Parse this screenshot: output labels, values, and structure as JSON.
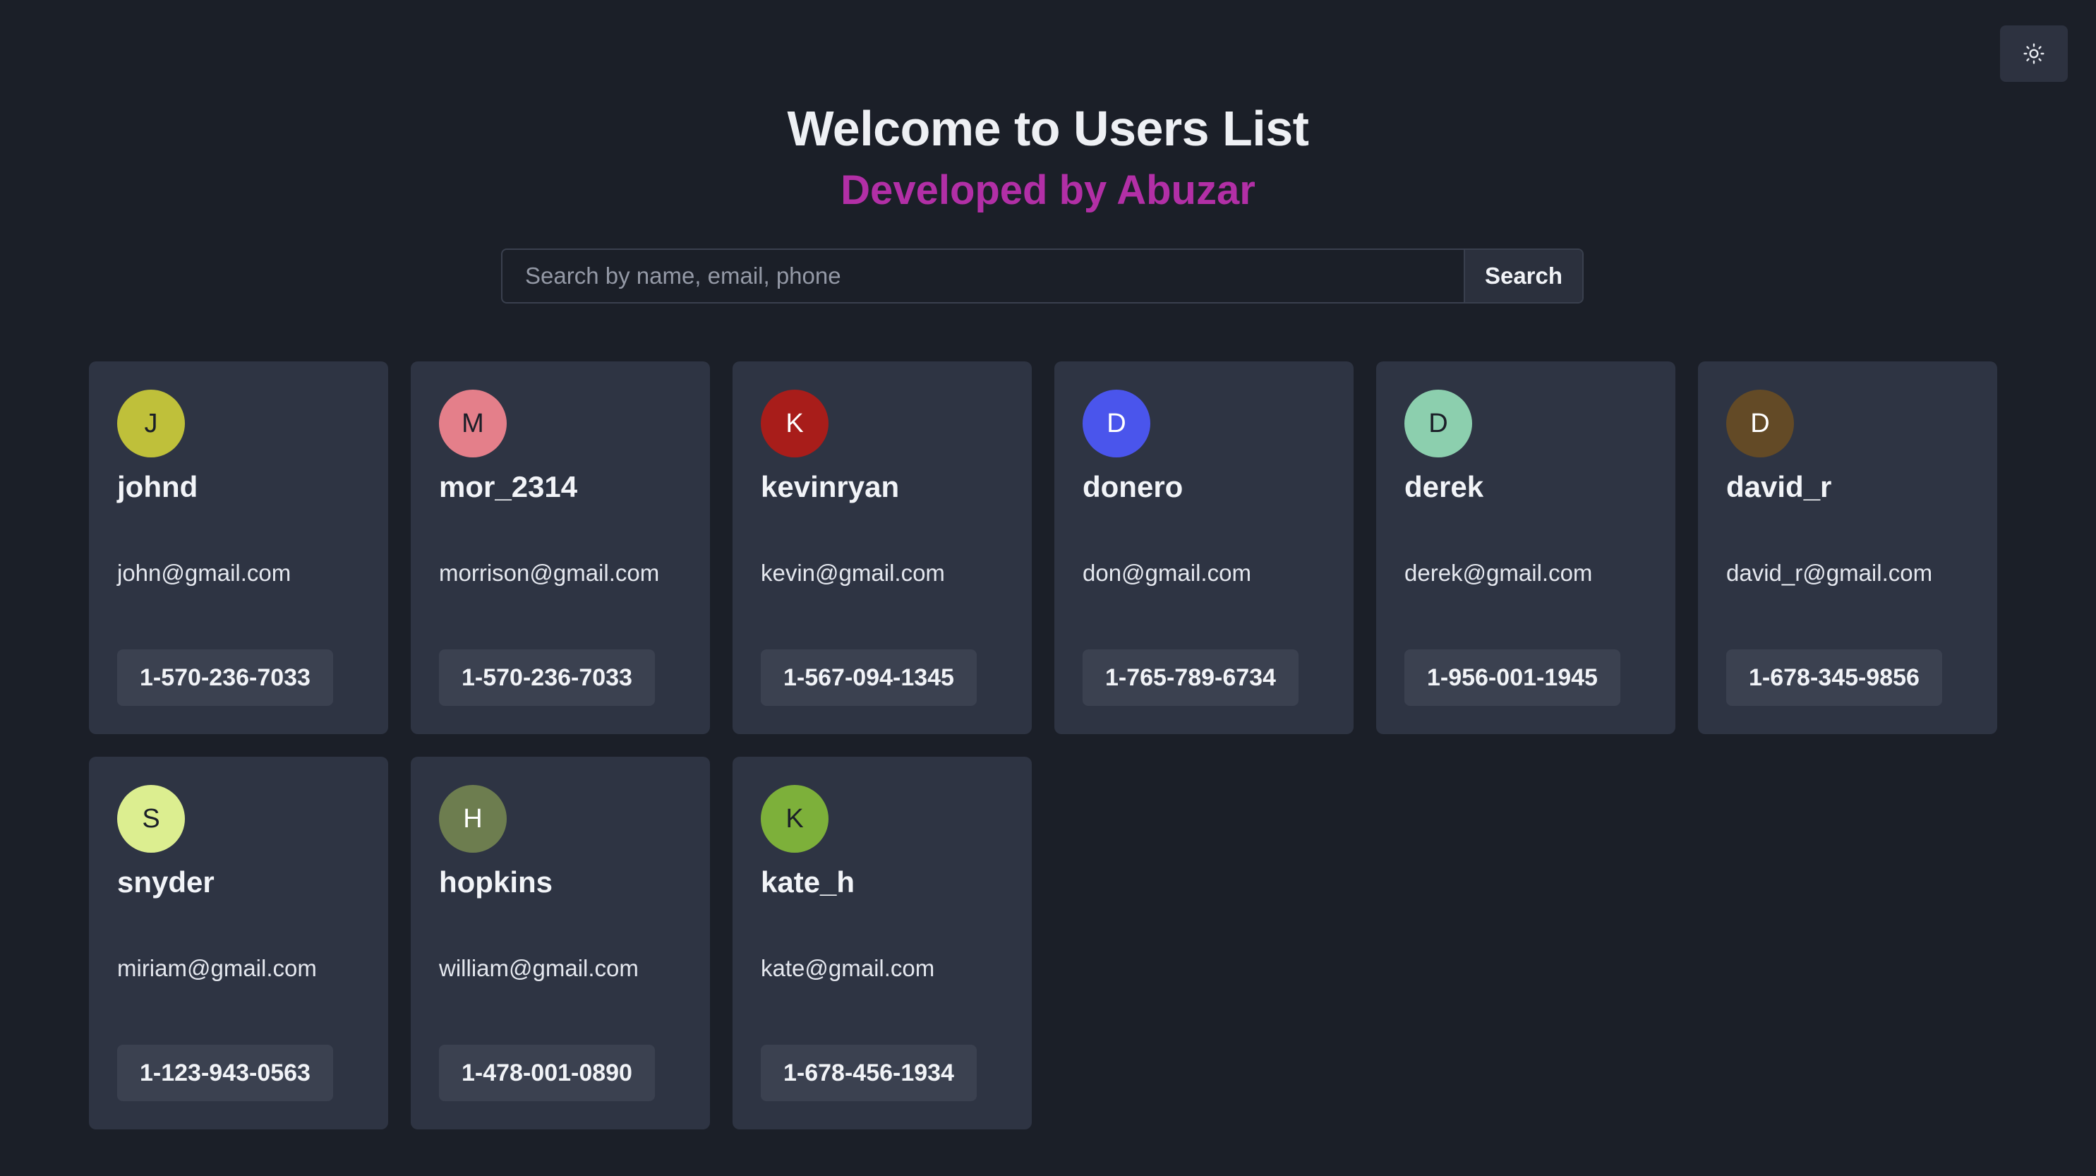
{
  "header": {
    "title": "Welcome to Users List",
    "subtitle": "Developed by Abuzar",
    "subtitle_color": "#b22fa6"
  },
  "theme_toggle": {
    "icon": "sun-icon"
  },
  "search": {
    "placeholder": "Search by name, email, phone",
    "value": "",
    "button_label": "Search"
  },
  "users": [
    {
      "initial": "J",
      "username": "johnd",
      "email": "john@gmail.com",
      "phone": "1-570-236-7033",
      "avatar_bg": "#bfc03a",
      "avatar_fg": "#1b1f28"
    },
    {
      "initial": "M",
      "username": "mor_2314",
      "email": "morrison@gmail.com",
      "phone": "1-570-236-7033",
      "avatar_bg": "#e47f8a",
      "avatar_fg": "#1b1f28"
    },
    {
      "initial": "K",
      "username": "kevinryan",
      "email": "kevin@gmail.com",
      "phone": "1-567-094-1345",
      "avatar_bg": "#a81d1a",
      "avatar_fg": "#ffffff"
    },
    {
      "initial": "D",
      "username": "donero",
      "email": "don@gmail.com",
      "phone": "1-765-789-6734",
      "avatar_bg": "#4a55ec",
      "avatar_fg": "#ffffff"
    },
    {
      "initial": "D",
      "username": "derek",
      "email": "derek@gmail.com",
      "phone": "1-956-001-1945",
      "avatar_bg": "#8ccfae",
      "avatar_fg": "#1b1f28"
    },
    {
      "initial": "D",
      "username": "david_r",
      "email": "david_r@gmail.com",
      "phone": "1-678-345-9856",
      "avatar_bg": "#634a26",
      "avatar_fg": "#ffffff"
    },
    {
      "initial": "S",
      "username": "snyder",
      "email": "miriam@gmail.com",
      "phone": "1-123-943-0563",
      "avatar_bg": "#dcee90",
      "avatar_fg": "#1b1f28"
    },
    {
      "initial": "H",
      "username": "hopkins",
      "email": "william@gmail.com",
      "phone": "1-478-001-0890",
      "avatar_bg": "#6d7d4f",
      "avatar_fg": "#ffffff"
    },
    {
      "initial": "K",
      "username": "kate_h",
      "email": "kate@gmail.com",
      "phone": "1-678-456-1934",
      "avatar_bg": "#7db03a",
      "avatar_fg": "#1b1f28"
    }
  ]
}
